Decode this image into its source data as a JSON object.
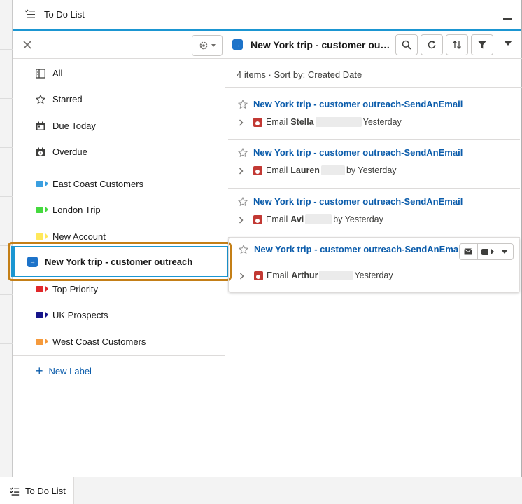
{
  "window": {
    "title": "To Do List"
  },
  "sidebar": {
    "views": [
      {
        "label": "All"
      },
      {
        "label": "Starred"
      },
      {
        "label": "Due Today"
      },
      {
        "label": "Overdue"
      }
    ],
    "labels": [
      {
        "label": "East Coast Customers",
        "color": "#3a9fe0"
      },
      {
        "label": "London Trip",
        "color": "#45d93e"
      },
      {
        "label": "New Account",
        "color": "#ffe85a"
      },
      {
        "label": "New York trip - customer outreach",
        "color": "#1d73c9",
        "selected": true
      },
      {
        "label": "Top Priority",
        "color": "#e0282a"
      },
      {
        "label": "UK Prospects",
        "color": "#16148a"
      },
      {
        "label": "West Coast Customers",
        "color": "#f59a3c"
      }
    ],
    "new_label": "New Label"
  },
  "main": {
    "title": "New York trip - customer outreach",
    "summary": "4 items · Sort by: Created Date",
    "tasks": [
      {
        "title": "New York trip - customer outreach-SendAnEmail",
        "type": "Email",
        "who": "Stella",
        "when": "Yesterday"
      },
      {
        "title": "New York trip - customer outreach-SendAnEmail",
        "type": "Email",
        "who": "Lauren",
        "when": "by Yesterday"
      },
      {
        "title": "New York trip - customer outreach-SendAnEmail",
        "type": "Email",
        "who": "Avi",
        "when": "by Yesterday"
      },
      {
        "title": "New York trip - customer outreach-SendAnEmail",
        "type": "Email",
        "who": "Arthur",
        "when": "Yesterday"
      }
    ]
  },
  "footer": {
    "tab_label": "To Do List"
  },
  "colors": {
    "accent": "#1b96d2",
    "link": "#0b5cab",
    "highlight": "#c47f17"
  }
}
